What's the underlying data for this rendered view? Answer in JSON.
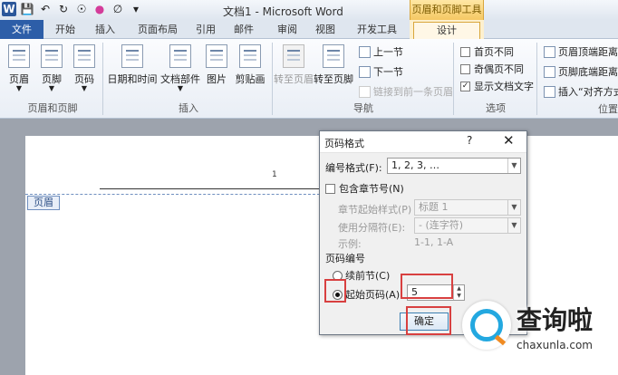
{
  "titlebar": {
    "doc_title": "文档1 - Microsoft Word",
    "context_title": "页眉和页脚工具",
    "qat_icons": [
      "word-logo-icon",
      "save-icon",
      "undo-icon",
      "redo-icon",
      "repeat-icon",
      "color-icon",
      "clear-icon",
      "customize-icon"
    ],
    "word_logo_letter": "W"
  },
  "tabs": [
    "文件",
    "开始",
    "插入",
    "页面布局",
    "引用",
    "邮件",
    "审阅",
    "视图",
    "开发工具",
    "设计"
  ],
  "ribbon": {
    "groups": {
      "header_footer": {
        "label": "页眉和页脚",
        "buttons": [
          "页眉",
          "页脚",
          "页码"
        ]
      },
      "insert": {
        "label": "插入",
        "buttons": [
          "日期和时间",
          "文档部件",
          "图片",
          "剪贴画"
        ]
      },
      "navigation": {
        "label": "导航",
        "buttons": [
          "转至页眉",
          "转至页脚"
        ],
        "small": [
          "上一节",
          "下一节",
          "链接到前一条页眉"
        ]
      },
      "options": {
        "label": "选项",
        "checks": [
          {
            "label": "首页不同",
            "checked": false
          },
          {
            "label": "奇偶页不同",
            "checked": false
          },
          {
            "label": "显示文档文字",
            "checked": true
          }
        ]
      },
      "position": {
        "label": "位置",
        "items": [
          "页眉顶端距离:",
          "页脚底端距离:",
          "插入“对齐方式”"
        ]
      }
    }
  },
  "document": {
    "header_tag": "页眉",
    "cursor_mark": "1"
  },
  "dialog": {
    "title": "页码格式",
    "help": "?",
    "close": "✕",
    "number_format_label": "编号格式(F):",
    "number_format_value": "1, 2, 3, …",
    "include_chapter_label": "包含章节号(N)",
    "include_chapter_checked": false,
    "chapter_style_label": "章节起始样式(P)",
    "chapter_style_value": "标题 1",
    "separator_label": "使用分隔符(E):",
    "separator_value": "-  (连字符)",
    "example_label": "示例:",
    "example_value": "1-1,  1-A",
    "section_label": "页码编号",
    "continue_label": "续前节(C)",
    "continue_selected": false,
    "start_label": "起始页码(A):",
    "start_selected": true,
    "start_value": "5",
    "ok_label": "确定"
  },
  "watermark": {
    "text": "查询啦",
    "url": "chaxunla.com"
  },
  "colors": {
    "file_tab": "#2d5ea8",
    "context_tab": "#f5c863",
    "highlight": "#d84040"
  }
}
